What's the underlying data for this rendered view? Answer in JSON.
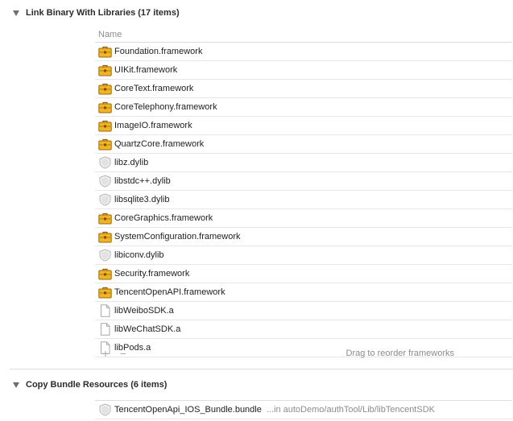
{
  "link_section": {
    "title": "Link Binary With Libraries (17 items)",
    "column_header": "Name",
    "items": [
      {
        "label": "Foundation.framework",
        "icon": "framework-toolbox-icon"
      },
      {
        "label": "UIKit.framework",
        "icon": "framework-toolbox-icon"
      },
      {
        "label": "CoreText.framework",
        "icon": "framework-toolbox-icon"
      },
      {
        "label": "CoreTelephony.framework",
        "icon": "framework-toolbox-icon"
      },
      {
        "label": "ImageIO.framework",
        "icon": "framework-toolbox-icon"
      },
      {
        "label": "QuartzCore.framework",
        "icon": "framework-toolbox-icon"
      },
      {
        "label": "libz.dylib",
        "icon": "dylib-shield-icon"
      },
      {
        "label": "libstdc++.dylib",
        "icon": "dylib-shield-icon"
      },
      {
        "label": "libsqlite3.dylib",
        "icon": "dylib-shield-icon"
      },
      {
        "label": "CoreGraphics.framework",
        "icon": "framework-toolbox-icon"
      },
      {
        "label": "SystemConfiguration.framework",
        "icon": "framework-toolbox-icon"
      },
      {
        "label": "libiconv.dylib",
        "icon": "dylib-shield-icon"
      },
      {
        "label": "Security.framework",
        "icon": "framework-toolbox-icon"
      },
      {
        "label": "TencentOpenAPI.framework",
        "icon": "framework-toolbox-icon"
      },
      {
        "label": "libWeiboSDK.a",
        "icon": "static-library-file-icon"
      },
      {
        "label": "libWeChatSDK.a",
        "icon": "static-library-file-icon"
      },
      {
        "label": "libPods.a",
        "icon": "static-library-file-icon"
      }
    ],
    "footer": {
      "add_symbol": "+",
      "remove_symbol": "−",
      "hint": "Drag to reorder frameworks"
    }
  },
  "copy_section": {
    "title": "Copy Bundle Resources (6 items)",
    "items": [
      {
        "label": "TencentOpenApi_IOS_Bundle.bundle",
        "path": "...in autoDemo/authTool/Lib/libTencentSDK",
        "icon": "bundle-shield-icon"
      }
    ]
  },
  "colors": {
    "framework_icon": "#e8a317",
    "shield_icon": "#c8c8c8",
    "text": "#1e1e1e",
    "muted_text": "#8c8c8c",
    "divider": "#dcdcdc"
  }
}
